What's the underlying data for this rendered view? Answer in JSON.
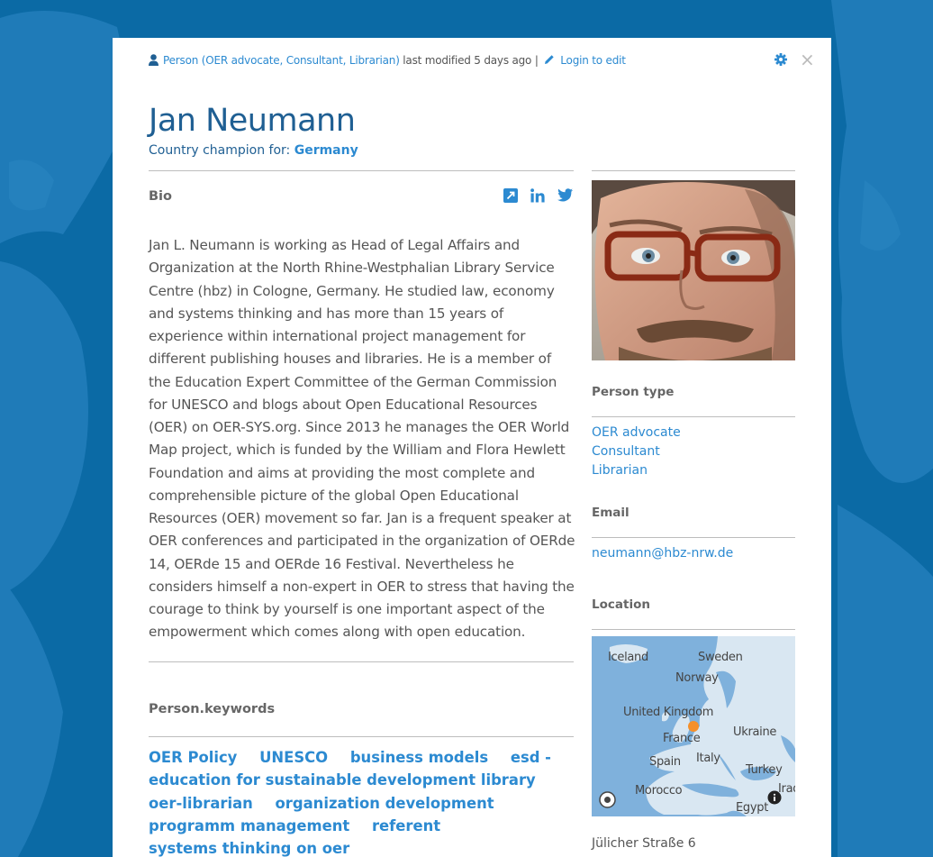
{
  "meta": {
    "type_prefix": "Person (",
    "type_1": "OER advocate",
    "type_sep1": ", ",
    "type_2": "Consultant",
    "type_sep2": ", ",
    "type_3": "Librarian",
    "type_suffix": ")",
    "modified": " last modified 5 days ago | ",
    "login": "Login to edit",
    "close": "×"
  },
  "person": {
    "name": "Jan Neumann",
    "champion_prefix": "Country champion for: ",
    "champion_country": "Germany"
  },
  "bio": {
    "label": "Bio",
    "text": "Jan L. Neumann is working as Head of Legal Affairs and Organization at the North Rhine-Westphalian Library Service Centre (hbz) in Cologne, Germany. He studied law, economy and systems thinking and has more than 15 years of experience within international project management for different publishing houses and libraries. He is a member of the Education Expert Committee of the German Commission for UNESCO and blogs about Open Educational Resources (OER) on OER-SYS.org. Since 2013 he manages the OER World Map project, which is funded by the William and Flora Hewlett Foundation and aims at providing the most complete and comprehensible picture of the global Open Educational Resources (OER) movement so far. Jan is a frequent speaker at OER conferences and participated in the organization of OERde 14, OERde 15 and OERde 16 Festival. Nevertheless he considers himself a non-expert in OER to stress that having the courage to think by yourself is one important aspect of the empowerment which comes along with open education."
  },
  "share_icons": [
    "external-link-icon",
    "linkedin-icon",
    "twitter-icon"
  ],
  "keywords": {
    "label": "Person.keywords",
    "items": [
      "OER Policy",
      "UNESCO",
      "business models",
      "esd - education for sustainable development library",
      "oer-librarian",
      "organization development",
      "programm management",
      "referent",
      "systems thinking on oer"
    ]
  },
  "sidebar": {
    "person_type_label": "Person type",
    "person_types": [
      "OER advocate",
      "Consultant",
      "Librarian"
    ],
    "email_label": "Email",
    "email": "neumann@hbz-nrw.de",
    "location_label": "Location",
    "map_labels": [
      "Iceland",
      "Sweden",
      "Norway",
      "United Kingdom",
      "France",
      "Ukraine",
      "Spain",
      "Italy",
      "Turkey",
      "Morocco",
      "Egypt",
      "Iraq"
    ],
    "address": "Jülicher Straße 6"
  },
  "colors": {
    "background": "#0b6aa5",
    "heading": "#1f5f93",
    "link": "#2c8ad1",
    "marker": "#f5902a"
  }
}
